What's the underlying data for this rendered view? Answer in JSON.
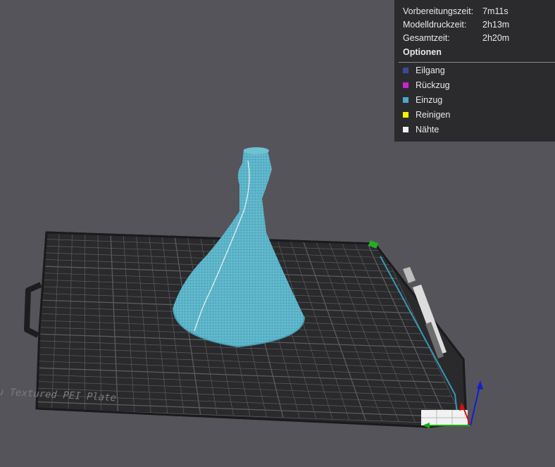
{
  "stats": [
    {
      "label": "Vorbereitungszeit:",
      "value": "7m11s"
    },
    {
      "label": "Modelldruckzeit:",
      "value": "2h13m"
    },
    {
      "label": "Gesamtzeit:",
      "value": "2h20m"
    }
  ],
  "options_title": "Optionen",
  "legend": [
    {
      "label": "Eilgang",
      "color": "#3a4a9a"
    },
    {
      "label": "Rückzug",
      "color": "#d020d0"
    },
    {
      "label": "Einzug",
      "color": "#4aa8cc"
    },
    {
      "label": "Reinigen",
      "color": "#f4f400"
    },
    {
      "label": "Nähte",
      "color": "#f0f0f0"
    }
  ],
  "plate_label": "Bambu Textured PEI Plate",
  "colors": {
    "background": "#55545a",
    "plate": "#2a2a2c",
    "grid": "#5c5c60",
    "model": "#5cb4c8",
    "axis_x": "#d01010",
    "axis_y": "#10b010",
    "axis_z": "#1020d0"
  }
}
